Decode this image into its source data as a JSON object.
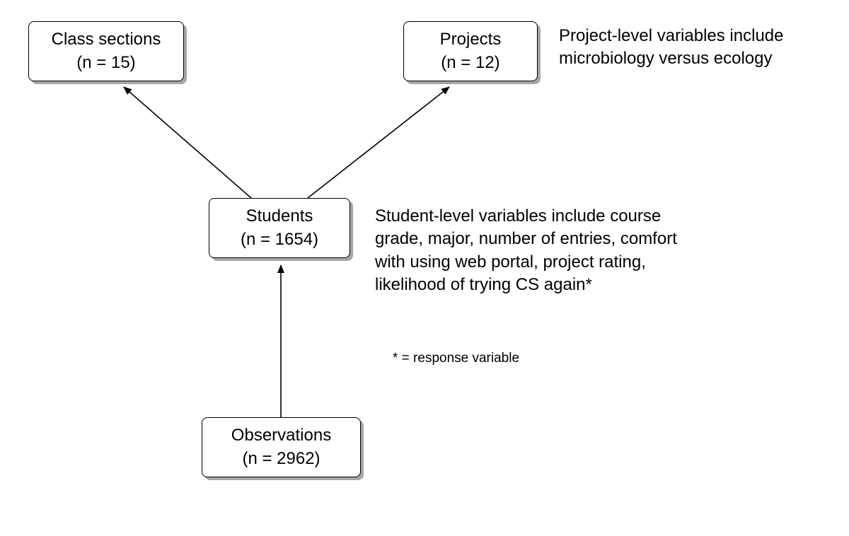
{
  "nodes": {
    "class_sections": {
      "title": "Class sections",
      "count": "(n = 15)"
    },
    "projects": {
      "title": "Projects",
      "count": "(n = 12)"
    },
    "students": {
      "title": "Students",
      "count": "(n = 1654)"
    },
    "observations": {
      "title": "Observations",
      "count": "(n = 2962)"
    }
  },
  "annotations": {
    "project_level": "Project-level variables include microbiology versus ecology",
    "student_level": "Student-level variables include course grade, major, number of entries, comfort with using web portal, project rating, likelihood of trying CS again*",
    "footnote": "* = response variable"
  }
}
